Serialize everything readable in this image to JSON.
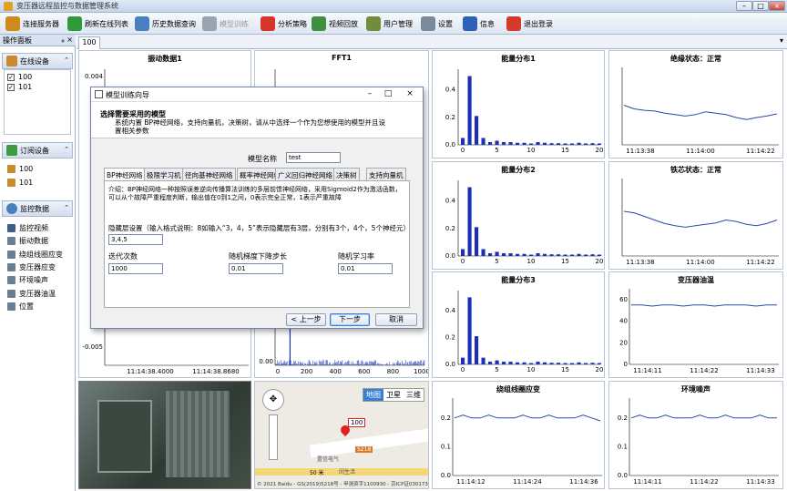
{
  "window": {
    "title": "变压器远程监控与数据管理系统"
  },
  "toolbar": [
    {
      "id": "connect",
      "label": "连接服务器",
      "color": "#d08a1c"
    },
    {
      "id": "refresh",
      "label": "刷新在线列表",
      "color": "#2e9a3a"
    },
    {
      "id": "history",
      "label": "历史数据查询",
      "color": "#4a7fbf"
    },
    {
      "id": "model",
      "label": "模型训练",
      "color": "#9aa4b0",
      "disabled": true
    },
    {
      "id": "analyze",
      "label": "分析策略",
      "color": "#d7342c"
    },
    {
      "id": "video",
      "label": "视频回放",
      "color": "#3f8f3f"
    },
    {
      "id": "users",
      "label": "用户管理",
      "color": "#6f8d3a"
    },
    {
      "id": "settings",
      "label": "设置",
      "color": "#7a8a9a"
    },
    {
      "id": "info",
      "label": "信息",
      "color": "#2d62b8"
    },
    {
      "id": "logout",
      "label": "退出登录",
      "color": "#d43a2c"
    }
  ],
  "sidebar": {
    "header": "操作面板",
    "pin": "ᵩ ×",
    "online_section": "在线设备",
    "online_devices": [
      "100",
      "101"
    ],
    "subscribed_section": "订阅设备",
    "subscribed_devices": [
      "100",
      "101"
    ],
    "monitor_section": "监控数据",
    "monitor_items": [
      {
        "label": "监控视频",
        "icon": "eye-icon",
        "color": "#3d5f8a"
      },
      {
        "label": "振动数据",
        "icon": "wave-icon",
        "color": "#6a7f95"
      },
      {
        "label": "绕组线圈应变",
        "icon": "grid-icon",
        "color": "#6a7f95"
      },
      {
        "label": "变压器应变",
        "icon": "grid-icon",
        "color": "#6a7f95"
      },
      {
        "label": "环境噪声",
        "icon": "grid-icon",
        "color": "#6a7f95"
      },
      {
        "label": "变压器油温",
        "icon": "grid-icon",
        "color": "#6a7f95"
      },
      {
        "label": "位置",
        "icon": "location-icon",
        "color": "#6a7f95"
      }
    ]
  },
  "tab": {
    "label": "100"
  },
  "panels": {
    "vibration": {
      "title": "振动数据1",
      "ytick_top": "0.004",
      "ytick_bottom": "-0.005",
      "xticks": [
        "11:14:38.4000",
        "11:14:38.8680"
      ]
    },
    "fft": {
      "title": "FFT1",
      "yticks": [
        "0.02",
        "0.00"
      ],
      "xticks": [
        "0",
        "200",
        "400",
        "600",
        "800",
        "1000"
      ]
    },
    "energy1": {
      "title": "能量分布1"
    },
    "energy2": {
      "title": "能量分布2"
    },
    "energy3": {
      "title": "能量分布3"
    },
    "insulation": {
      "title": "绝缘状态：正常",
      "xticks": [
        "11:13:38",
        "11:14:00",
        "11:14:22"
      ]
    },
    "iron": {
      "title": "铁芯状态：正常",
      "xticks": [
        "11:13:38",
        "11:14:00",
        "11:14:22"
      ]
    },
    "oiltemp": {
      "title": "变压器油温",
      "yticks": [
        "60",
        "40",
        "20",
        "0"
      ],
      "xticks": [
        "11:14:11",
        "11:14:22",
        "11:14:33"
      ]
    },
    "winding": {
      "title": "绕组线圈应变",
      "yticks": [
        "0.2",
        "0.1",
        "0.0"
      ],
      "xticks": [
        "11:14:12",
        "11:14:24",
        "11:14:36"
      ]
    },
    "noise": {
      "title": "环境噪声",
      "yticks": [
        "0.2",
        "0.1",
        "0.0"
      ],
      "xticks": [
        "11:14:11",
        "11:14:22",
        "11:14:33"
      ]
    }
  },
  "energy_yticks": [
    "0.4",
    "0.2",
    "0.0"
  ],
  "energy_xticks": [
    "0",
    "5",
    "10",
    "15",
    "20"
  ],
  "energy_values": [
    0.05,
    0.5,
    0.21,
    0.05,
    0.02,
    0.03,
    0.02,
    0.02,
    0.015,
    0.015,
    0.01,
    0.02,
    0.015,
    0.012,
    0.012,
    0.01,
    0.01,
    0.015,
    0.01,
    0.012,
    0.01
  ],
  "curve_values": {
    "insulation": [
      0.55,
      0.5,
      0.48,
      0.47,
      0.44,
      0.42,
      0.4,
      0.42,
      0.46,
      0.44,
      0.42,
      0.38,
      0.35,
      0.38,
      0.4,
      0.43
    ],
    "iron": [
      0.62,
      0.6,
      0.55,
      0.5,
      0.45,
      0.42,
      0.4,
      0.42,
      0.44,
      0.46,
      0.5,
      0.48,
      0.44,
      0.42,
      0.45,
      0.5
    ],
    "oiltemp": [
      55,
      55,
      54,
      55,
      55,
      54,
      55,
      55,
      54,
      55,
      55,
      55,
      54,
      55,
      55
    ],
    "winding": [
      0.2,
      0.21,
      0.2,
      0.2,
      0.21,
      0.2,
      0.2,
      0.2,
      0.21,
      0.2,
      0.2,
      0.21,
      0.2,
      0.2,
      0.2,
      0.21,
      0.2,
      0.19
    ],
    "noise": [
      0.2,
      0.21,
      0.2,
      0.2,
      0.21,
      0.2,
      0.2,
      0.2,
      0.21,
      0.2,
      0.2,
      0.21,
      0.2,
      0.2,
      0.2,
      0.21,
      0.2,
      0.2
    ]
  },
  "map": {
    "types": [
      "地图",
      "卫星",
      "三维"
    ],
    "marker": "100",
    "place1": "置信电气",
    "place2": "闵生活",
    "road": "S218",
    "scale": "50 米",
    "copyright": "© 2021 Baidu - GS(2019)5218号 - 甲测资字1100930 - 京ICP证030173号 - Data © 长地万方"
  },
  "dialog": {
    "title": "模型训练向导",
    "heading": "选择需要采用的模型",
    "desc": "系统内置 BP神经网络，支持向量机，决策树，请从中选择一个作为您想使用的模型并且设置相关参数",
    "model_name_label": "模型名称",
    "model_name": "test",
    "tabs": [
      "BP神经网络",
      "极限学习机",
      "径向基神经网络",
      "概率神经网络",
      "广义回归神经网络",
      "决策树",
      "支持向量机"
    ],
    "intro": "介绍：BP神经网络一种按照误差逆向传播算法训练的多层前馈神经网络，采用Sigmoid2作为激活函数，可以从个故障严重程度判断，输出值在0到1之间，0表示完全正常，1表示严重故障",
    "hidden_label": "隐藏层设置（输入格式说明：8如输入“3，4，5”表示隐藏层有3层，分别有3个，4个，5个神经元）",
    "hidden_value": "3,4,5",
    "iter_label": "迭代次数",
    "iter_value": "1000",
    "sgd_label": "随机梯度下降步长",
    "sgd_value": "0.01",
    "lr_label": "随机学习率",
    "lr_value": "0.01",
    "prev": "< 上一步",
    "next": "下一步",
    "cancel": "取消"
  },
  "colors": {
    "bar": "#1c2fb8",
    "line": "#2b4aa6",
    "vibration": "#1a1ab8"
  }
}
